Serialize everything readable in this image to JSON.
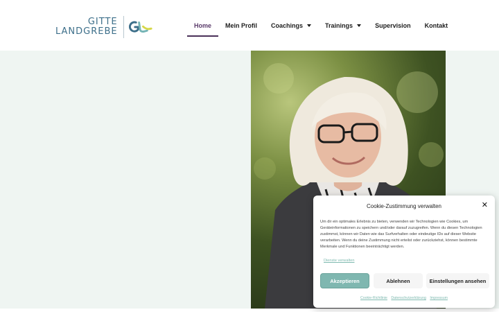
{
  "logo": {
    "line1": "GITTE",
    "line2": "LANDGREBE"
  },
  "nav": {
    "items": [
      {
        "label": "Home"
      },
      {
        "label": "Mein Profil"
      },
      {
        "label": "Coachings"
      },
      {
        "label": "Trainings"
      },
      {
        "label": "Supervision"
      },
      {
        "label": "Kontakt"
      }
    ]
  },
  "colors": {
    "accent_purple": "#4a3058",
    "logo_teal": "#3d6f8a",
    "hero_bg": "#eff5f2",
    "accept_button": "#7fb7b0"
  },
  "cookie": {
    "title": "Cookie-Zustimmung verwalten",
    "close_icon": "close-icon",
    "text": "Um dir ein optimales Erlebnis zu bieten, verwenden wir Technologien wie Cookies, um Geräteinformationen zu speichern und/oder darauf zuzugreifen. Wenn du diesen Technologien zustimmst, können wir Daten wie das Surfverhalten oder eindeutige IDs auf dieser Website verarbeiten. Wenn du deine Zustimmung nicht erteilst oder zurückziehst, können bestimmte Merkmale und Funktionen beeinträchtigt werden.",
    "manage_link": "Dienste verwalten",
    "accept": "Akzeptieren",
    "deny": "Ablehnen",
    "settings": "Einstellungen ansehen",
    "links": [
      "Cookie-Richtlinie",
      "Datenschutzerklärung",
      "Impressum"
    ]
  }
}
